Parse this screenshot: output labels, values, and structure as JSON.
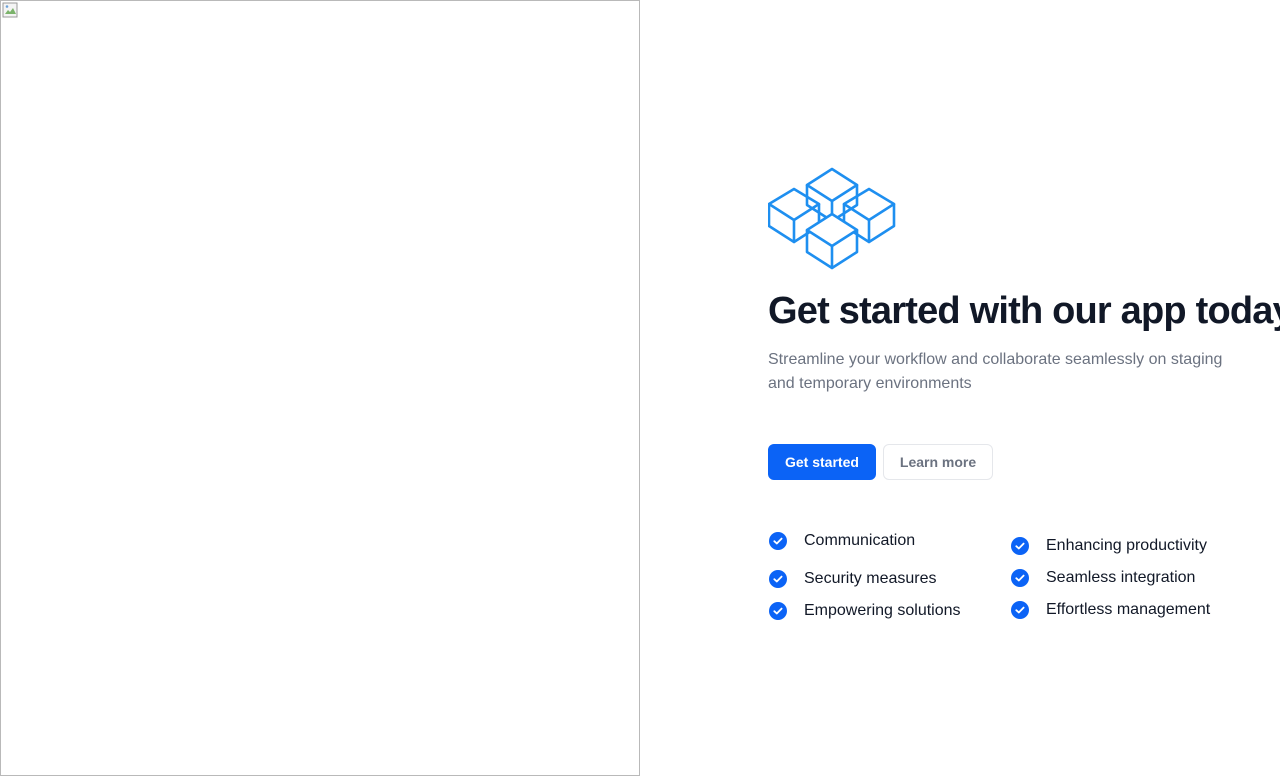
{
  "hero": {
    "icon": "broken-image-icon"
  },
  "brand": {
    "logo_icon": "cubes-logo-icon",
    "accent_color": "#1e8ff0"
  },
  "title": "Get started with our app today",
  "subtitle": "Streamline your workflow and collaborate seamlessly on staging and temporary environments",
  "actions": {
    "primary_label": "Get started",
    "secondary_label": "Learn more",
    "primary_color": "#0b63f6"
  },
  "features": {
    "check_icon": "check-circle-icon",
    "left": [
      {
        "label": "Communication"
      },
      {
        "label": "Security measures"
      },
      {
        "label": "Empowering solutions"
      }
    ],
    "right": [
      {
        "label": "Enhancing productivity"
      },
      {
        "label": "Seamless integration"
      },
      {
        "label": "Effortless management"
      }
    ]
  }
}
